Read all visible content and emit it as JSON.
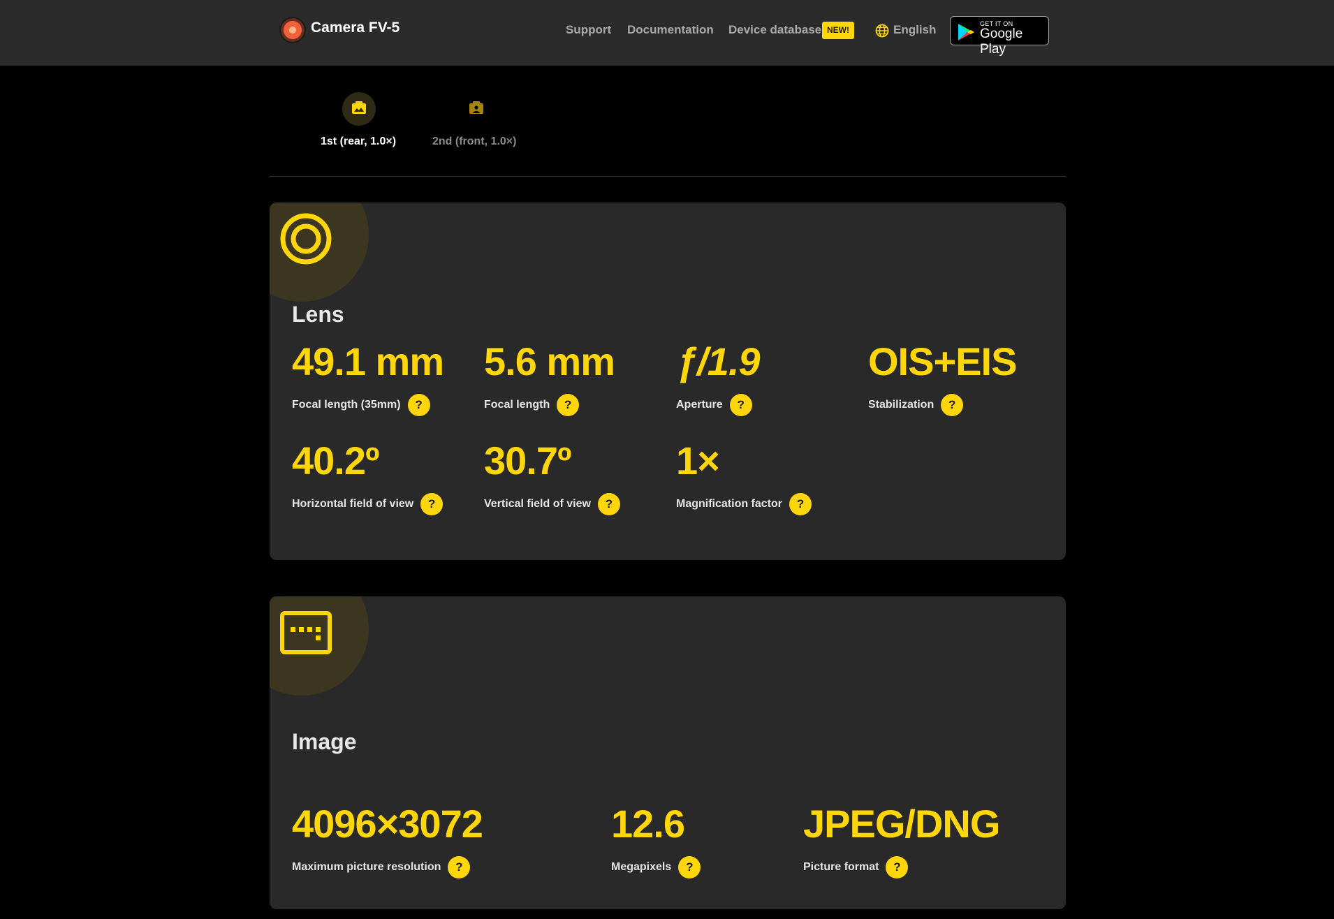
{
  "header": {
    "brand": "Camera FV-5",
    "nav": {
      "support": "Support",
      "documentation": "Documentation",
      "device_database": "Device database",
      "new_badge": "NEW!"
    },
    "language": "English",
    "google_play": {
      "small": "GET IT ON",
      "big": "Google Play"
    }
  },
  "tabs": [
    {
      "label": "1st (rear, 1.0×)",
      "active": true
    },
    {
      "label": "2nd (front, 1.0×)",
      "active": false
    }
  ],
  "lens": {
    "title": "Lens",
    "stats": [
      {
        "value": "49.1 mm",
        "label": "Focal length (35mm)"
      },
      {
        "value": "5.6 mm",
        "label": "Focal length"
      },
      {
        "value": "ƒ/1.9",
        "label": "Aperture"
      },
      {
        "value": "OIS+EIS",
        "label": "Stabilization"
      },
      {
        "value": "40.2º",
        "label": "Horizontal field of view"
      },
      {
        "value": "30.7º",
        "label": "Vertical field of view"
      },
      {
        "value": "1×",
        "label": "Magnification factor"
      }
    ]
  },
  "image": {
    "title": "Image",
    "stats": [
      {
        "value": "4096×3072",
        "label": "Maximum picture resolution"
      },
      {
        "value": "12.6",
        "label": "Megapixels"
      },
      {
        "value": "JPEG/DNG",
        "label": "Picture format"
      }
    ]
  },
  "help_glyph": "?",
  "colors": {
    "accent": "#ffd60a",
    "header_bg": "#2b2b2b",
    "card_bg": "#292929",
    "page_bg": "#000000"
  }
}
